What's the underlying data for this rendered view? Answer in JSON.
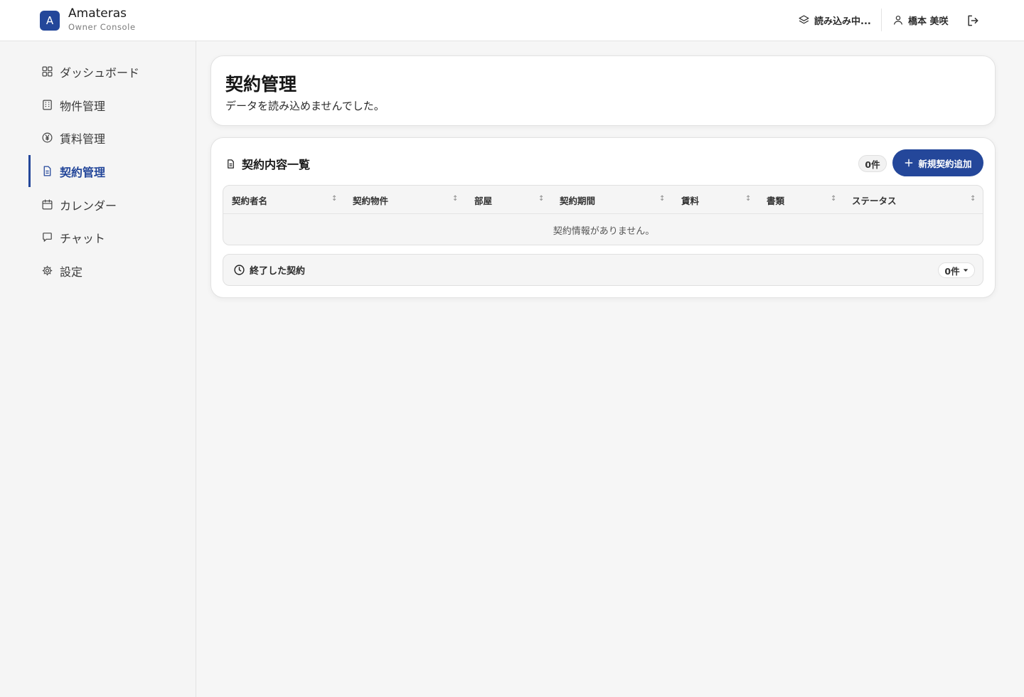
{
  "header": {
    "logo_letter": "A",
    "brand_name": "Amateras",
    "brand_sub": "Owner Console",
    "loading_label": "読み込み中...",
    "user_name": "橋本 美咲"
  },
  "sidebar": {
    "items": [
      {
        "label": "ダッシュボード",
        "icon": "dashboard-icon"
      },
      {
        "label": "物件管理",
        "icon": "building-icon"
      },
      {
        "label": "賃料管理",
        "icon": "yen-circle-icon"
      },
      {
        "label": "契約管理",
        "icon": "document-icon",
        "active": true
      },
      {
        "label": "カレンダー",
        "icon": "calendar-icon"
      },
      {
        "label": "チャット",
        "icon": "chat-icon"
      },
      {
        "label": "設定",
        "icon": "gear-icon"
      }
    ]
  },
  "page": {
    "title": "契約管理",
    "subtitle": "データを読み込めませんでした。"
  },
  "contracts": {
    "title": "契約内容一覧",
    "count": "0件",
    "add_button": "新規契約追加",
    "columns": [
      "契約者名",
      "契約物件",
      "部屋",
      "契約期間",
      "賃料",
      "書類",
      "ステータス"
    ],
    "empty_message": "契約情報がありません。"
  },
  "ended": {
    "title": "終了した契約",
    "count": "0件"
  },
  "colors": {
    "accent": "#24479a",
    "background": "#f6f6f6",
    "card": "#ffffff"
  }
}
